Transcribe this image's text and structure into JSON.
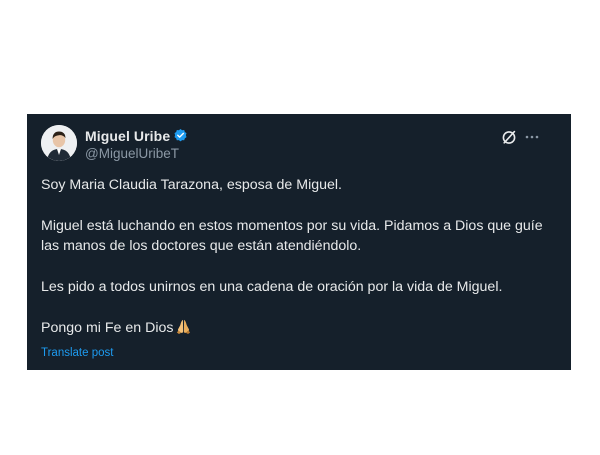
{
  "tweet": {
    "author": {
      "display_name": "Miguel Uribe",
      "handle": "@MiguelUribeT",
      "verified": true,
      "avatar_icon": "avatar-portrait"
    },
    "body": [
      "Soy Maria Claudia Tarazona, esposa de Miguel.",
      "Miguel está luchando en estos momentos por su vida. Pidamos a Dios que guíe las manos de los doctores que están atendiéndolo.",
      "Les pido a todos unirnos en una cadena de oración por la vida de Miguel.",
      "Pongo mi Fe en Dios"
    ],
    "emoji": "praying-hands-icon",
    "translate_label": "Translate post"
  },
  "icons": {
    "verified": "verified-badge-icon",
    "grok": "grok-icon",
    "more": "more-options-icon"
  },
  "colors": {
    "card_background": "#15202b",
    "text_primary": "#e7e9ea",
    "text_secondary": "#8b98a5",
    "accent": "#1d9bf0"
  }
}
